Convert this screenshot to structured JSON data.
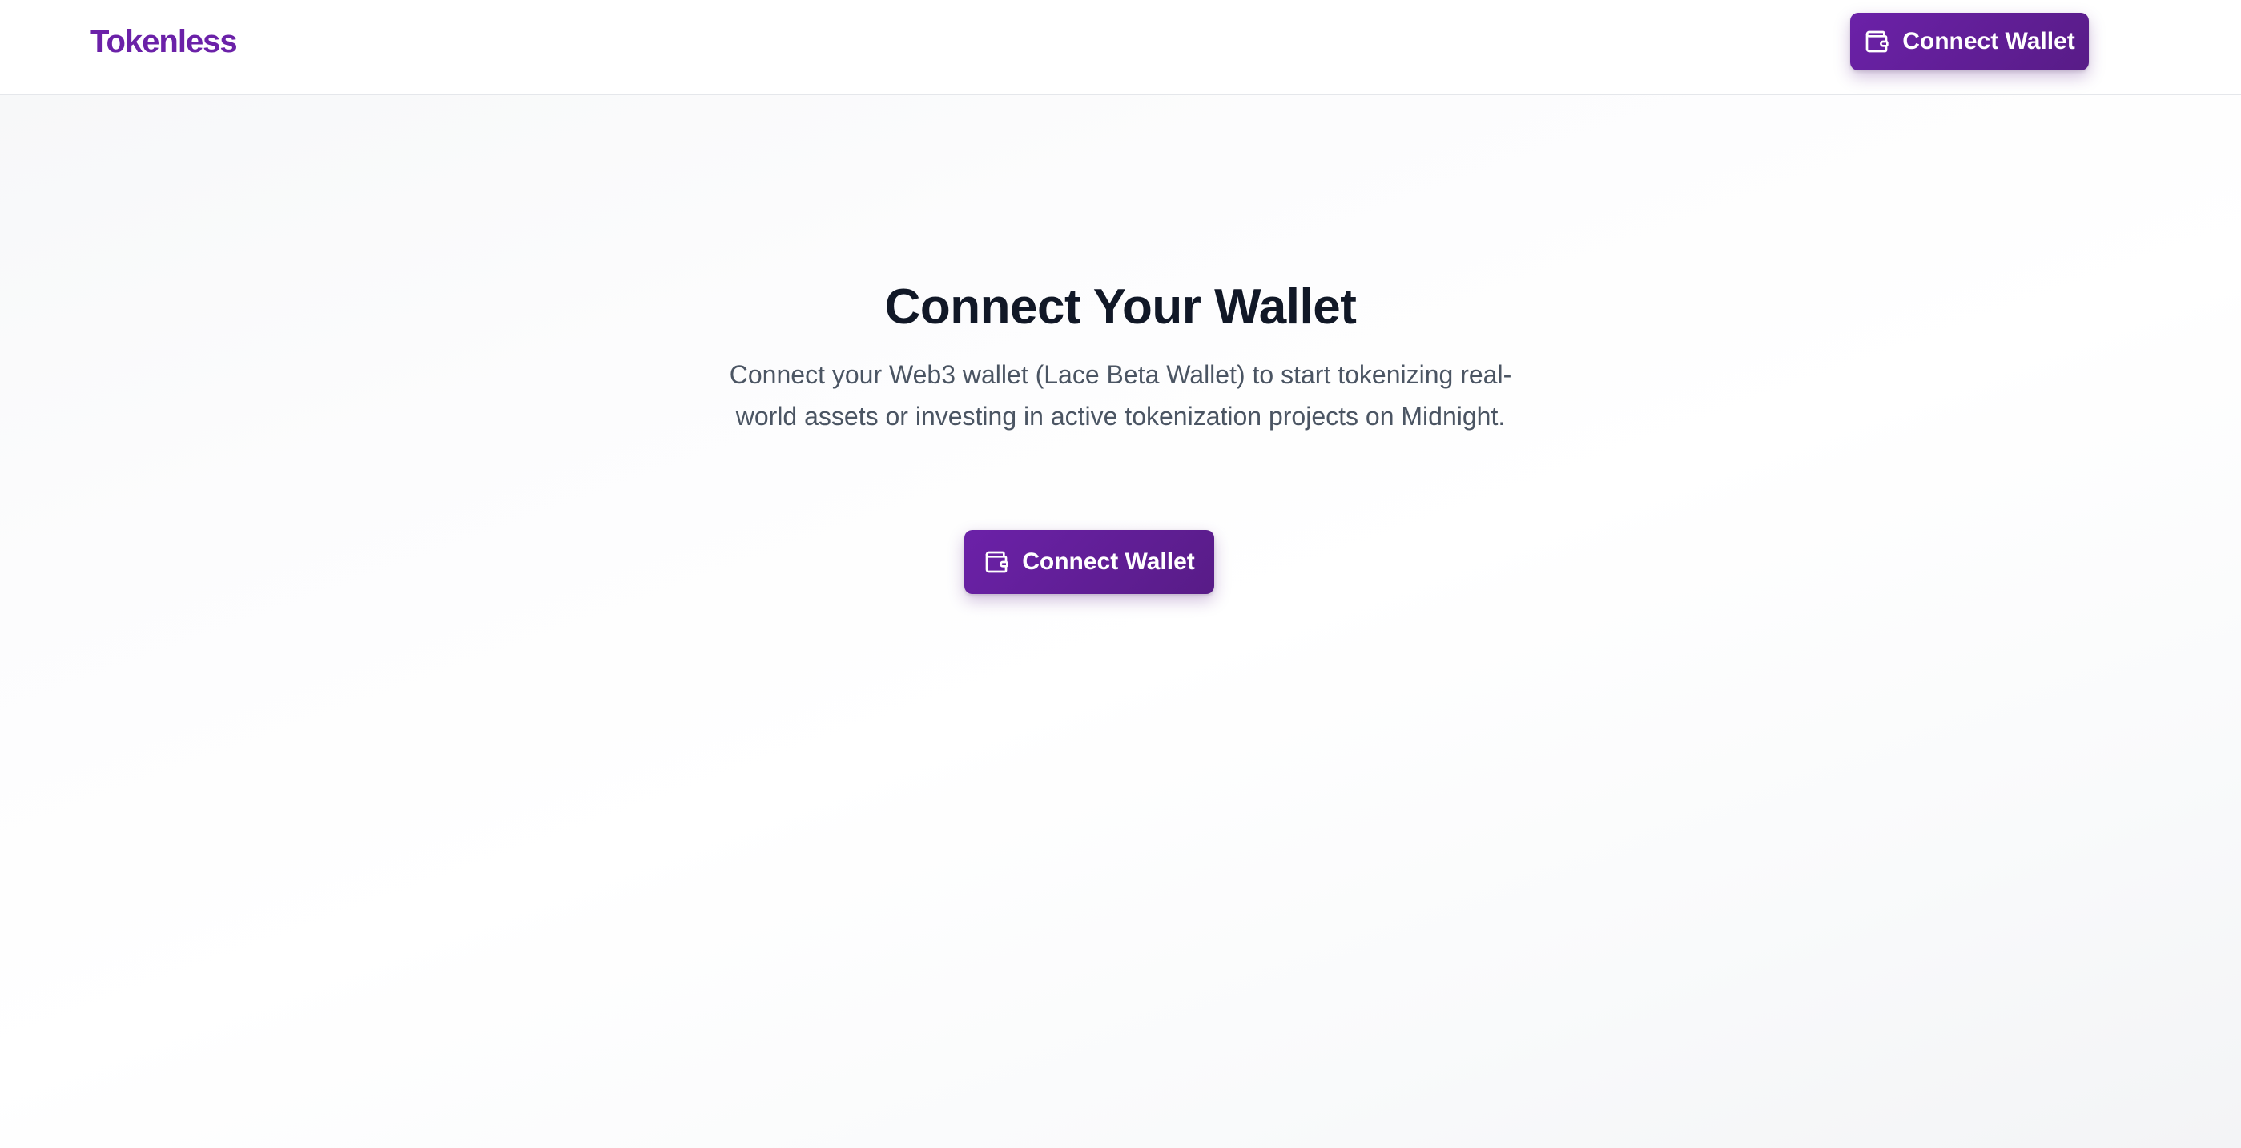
{
  "header": {
    "brand": "Tokenless",
    "connect_button_label": "Connect Wallet",
    "connect_button_icon": "wallet-icon"
  },
  "hero": {
    "title": "Connect Your Wallet",
    "description": "Connect your Web3 wallet (Lace Beta Wallet) to start tokenizing real-world assets or investing in active tokenization projects on Midnight.",
    "connect_button_label": "Connect Wallet",
    "connect_button_icon": "wallet-icon"
  },
  "colors": {
    "brand": "#6b21a8",
    "button_gradient_start": "#6b21a8",
    "button_gradient_end": "#581c87",
    "title": "#111827",
    "body_text": "#4b5563"
  }
}
